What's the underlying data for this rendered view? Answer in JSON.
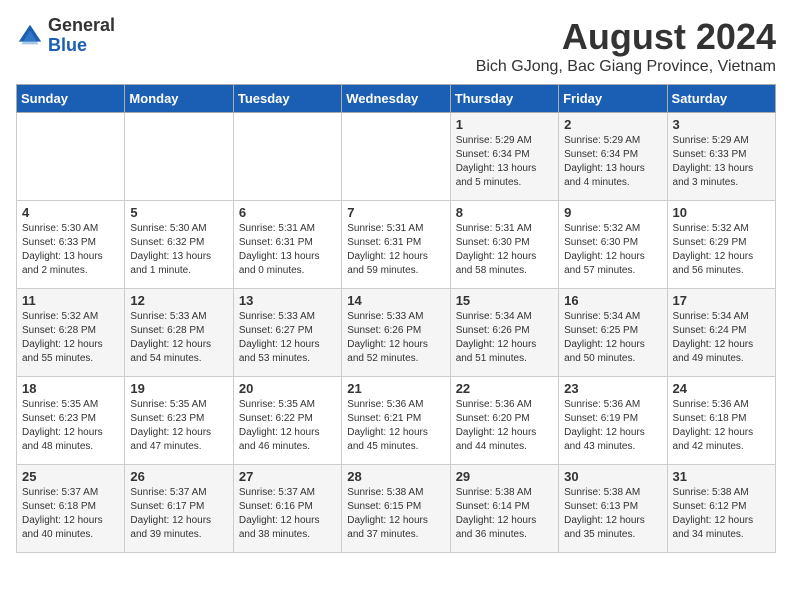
{
  "header": {
    "logo_general": "General",
    "logo_blue": "Blue",
    "title": "August 2024",
    "subtitle": "Bich GJong, Bac Giang Province, Vietnam"
  },
  "weekdays": [
    "Sunday",
    "Monday",
    "Tuesday",
    "Wednesday",
    "Thursday",
    "Friday",
    "Saturday"
  ],
  "weeks": [
    [
      {
        "day": "",
        "info": ""
      },
      {
        "day": "",
        "info": ""
      },
      {
        "day": "",
        "info": ""
      },
      {
        "day": "",
        "info": ""
      },
      {
        "day": "1",
        "info": "Sunrise: 5:29 AM\nSunset: 6:34 PM\nDaylight: 13 hours\nand 5 minutes."
      },
      {
        "day": "2",
        "info": "Sunrise: 5:29 AM\nSunset: 6:34 PM\nDaylight: 13 hours\nand 4 minutes."
      },
      {
        "day": "3",
        "info": "Sunrise: 5:29 AM\nSunset: 6:33 PM\nDaylight: 13 hours\nand 3 minutes."
      }
    ],
    [
      {
        "day": "4",
        "info": "Sunrise: 5:30 AM\nSunset: 6:33 PM\nDaylight: 13 hours\nand 2 minutes."
      },
      {
        "day": "5",
        "info": "Sunrise: 5:30 AM\nSunset: 6:32 PM\nDaylight: 13 hours\nand 1 minute."
      },
      {
        "day": "6",
        "info": "Sunrise: 5:31 AM\nSunset: 6:31 PM\nDaylight: 13 hours\nand 0 minutes."
      },
      {
        "day": "7",
        "info": "Sunrise: 5:31 AM\nSunset: 6:31 PM\nDaylight: 12 hours\nand 59 minutes."
      },
      {
        "day": "8",
        "info": "Sunrise: 5:31 AM\nSunset: 6:30 PM\nDaylight: 12 hours\nand 58 minutes."
      },
      {
        "day": "9",
        "info": "Sunrise: 5:32 AM\nSunset: 6:30 PM\nDaylight: 12 hours\nand 57 minutes."
      },
      {
        "day": "10",
        "info": "Sunrise: 5:32 AM\nSunset: 6:29 PM\nDaylight: 12 hours\nand 56 minutes."
      }
    ],
    [
      {
        "day": "11",
        "info": "Sunrise: 5:32 AM\nSunset: 6:28 PM\nDaylight: 12 hours\nand 55 minutes."
      },
      {
        "day": "12",
        "info": "Sunrise: 5:33 AM\nSunset: 6:28 PM\nDaylight: 12 hours\nand 54 minutes."
      },
      {
        "day": "13",
        "info": "Sunrise: 5:33 AM\nSunset: 6:27 PM\nDaylight: 12 hours\nand 53 minutes."
      },
      {
        "day": "14",
        "info": "Sunrise: 5:33 AM\nSunset: 6:26 PM\nDaylight: 12 hours\nand 52 minutes."
      },
      {
        "day": "15",
        "info": "Sunrise: 5:34 AM\nSunset: 6:26 PM\nDaylight: 12 hours\nand 51 minutes."
      },
      {
        "day": "16",
        "info": "Sunrise: 5:34 AM\nSunset: 6:25 PM\nDaylight: 12 hours\nand 50 minutes."
      },
      {
        "day": "17",
        "info": "Sunrise: 5:34 AM\nSunset: 6:24 PM\nDaylight: 12 hours\nand 49 minutes."
      }
    ],
    [
      {
        "day": "18",
        "info": "Sunrise: 5:35 AM\nSunset: 6:23 PM\nDaylight: 12 hours\nand 48 minutes."
      },
      {
        "day": "19",
        "info": "Sunrise: 5:35 AM\nSunset: 6:23 PM\nDaylight: 12 hours\nand 47 minutes."
      },
      {
        "day": "20",
        "info": "Sunrise: 5:35 AM\nSunset: 6:22 PM\nDaylight: 12 hours\nand 46 minutes."
      },
      {
        "day": "21",
        "info": "Sunrise: 5:36 AM\nSunset: 6:21 PM\nDaylight: 12 hours\nand 45 minutes."
      },
      {
        "day": "22",
        "info": "Sunrise: 5:36 AM\nSunset: 6:20 PM\nDaylight: 12 hours\nand 44 minutes."
      },
      {
        "day": "23",
        "info": "Sunrise: 5:36 AM\nSunset: 6:19 PM\nDaylight: 12 hours\nand 43 minutes."
      },
      {
        "day": "24",
        "info": "Sunrise: 5:36 AM\nSunset: 6:18 PM\nDaylight: 12 hours\nand 42 minutes."
      }
    ],
    [
      {
        "day": "25",
        "info": "Sunrise: 5:37 AM\nSunset: 6:18 PM\nDaylight: 12 hours\nand 40 minutes."
      },
      {
        "day": "26",
        "info": "Sunrise: 5:37 AM\nSunset: 6:17 PM\nDaylight: 12 hours\nand 39 minutes."
      },
      {
        "day": "27",
        "info": "Sunrise: 5:37 AM\nSunset: 6:16 PM\nDaylight: 12 hours\nand 38 minutes."
      },
      {
        "day": "28",
        "info": "Sunrise: 5:38 AM\nSunset: 6:15 PM\nDaylight: 12 hours\nand 37 minutes."
      },
      {
        "day": "29",
        "info": "Sunrise: 5:38 AM\nSunset: 6:14 PM\nDaylight: 12 hours\nand 36 minutes."
      },
      {
        "day": "30",
        "info": "Sunrise: 5:38 AM\nSunset: 6:13 PM\nDaylight: 12 hours\nand 35 minutes."
      },
      {
        "day": "31",
        "info": "Sunrise: 5:38 AM\nSunset: 6:12 PM\nDaylight: 12 hours\nand 34 minutes."
      }
    ]
  ]
}
